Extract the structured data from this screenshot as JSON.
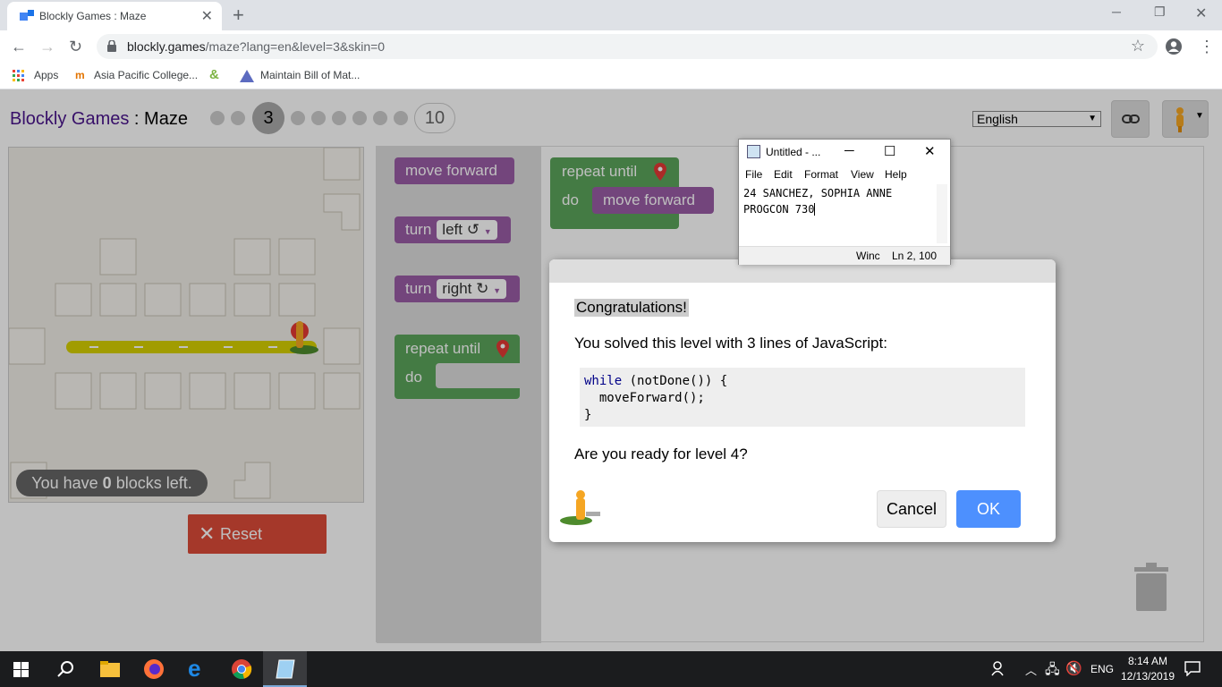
{
  "browser": {
    "tab_title": "Blockly Games : Maze",
    "url_host": "blockly.games",
    "url_path": "/maze?lang=en&level=3&skin=0",
    "bookmarks": [
      "Apps",
      "Asia Pacific College...",
      "Maintain Bill of Mat..."
    ]
  },
  "page": {
    "title_games": "Blockly Games",
    "title_sep": " : ",
    "title_maze": "Maze",
    "level_current": "3",
    "level_last": "10",
    "language": "English"
  },
  "maze": {
    "blocks_left_prefix": "You have ",
    "blocks_left_count": "0",
    "blocks_left_suffix": " blocks left.",
    "reset_label": "Reset"
  },
  "toolbox": {
    "move_forward": "move forward",
    "turn": "turn",
    "left": "left ↺",
    "right": "right ↻",
    "repeat_until": "repeat until",
    "do": "do"
  },
  "workspace": {
    "repeat_until": "repeat until",
    "do": "do",
    "move_forward": "move forward"
  },
  "dialog": {
    "congrats": "Congratulations!",
    "solved": "You solved this level with 3 lines of JavaScript:",
    "code_line1_kw": "while",
    "code_line1_rest": " (notDone()) {",
    "code_line2": "  moveForward();",
    "code_line3": "}",
    "ready": "Are you ready for level 4?",
    "cancel": "Cancel",
    "ok": "OK"
  },
  "notepad": {
    "title": "Untitled - ...",
    "menu": [
      "File",
      "Edit",
      "Format",
      "View",
      "Help"
    ],
    "line1": "24 SANCHEZ, SOPHIA ANNE",
    "line2": "PROGCON 730",
    "status_win": "Winc",
    "status_pos": "Ln 2,",
    "status_zoom": "100"
  },
  "taskbar": {
    "lang": "ENG",
    "time": "8:14 AM",
    "date": "12/13/2019"
  },
  "colors": {
    "accent_blue": "#4d90fe",
    "reset_red": "#dd4b39",
    "loop_green": "#5ba55b",
    "move_purple": "#9a5ca6"
  }
}
